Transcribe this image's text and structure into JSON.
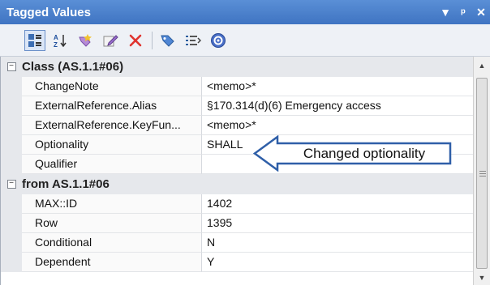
{
  "window": {
    "title": "Tagged Values",
    "controls": [
      "▼",
      "ᵖ",
      "✕"
    ]
  },
  "toolbar": {
    "icons": [
      "categorized-icon",
      "sort-alpha-icon",
      "add-tag-icon",
      "edit-tag-icon",
      "delete-icon",
      "tag-icon",
      "list-icon",
      "help-icon"
    ]
  },
  "categories": [
    {
      "name": "Class (AS.1.1#06)",
      "rows": [
        {
          "name": "ChangeNote",
          "value": "<memo>*"
        },
        {
          "name": "ExternalReference.Alias",
          "value": "§170.314(d)(6) Emergency access"
        },
        {
          "name": "ExternalReference.KeyFun...",
          "value": "<memo>*"
        },
        {
          "name": "Optionality",
          "value": "SHALL"
        },
        {
          "name": "Qualifier",
          "value": ""
        }
      ]
    },
    {
      "name": "from AS.1.1#06",
      "rows": [
        {
          "name": "MAX::ID",
          "value": "1402"
        },
        {
          "name": "Row",
          "value": "1395"
        },
        {
          "name": "Conditional",
          "value": "N"
        },
        {
          "name": "Dependent",
          "value": "Y"
        }
      ]
    }
  ],
  "annotation": {
    "text": "Changed optionality"
  },
  "colors": {
    "titlebar": "#4a80cc",
    "category_bg": "#e6e8ec",
    "arrow_stroke": "#2f5fa8"
  }
}
